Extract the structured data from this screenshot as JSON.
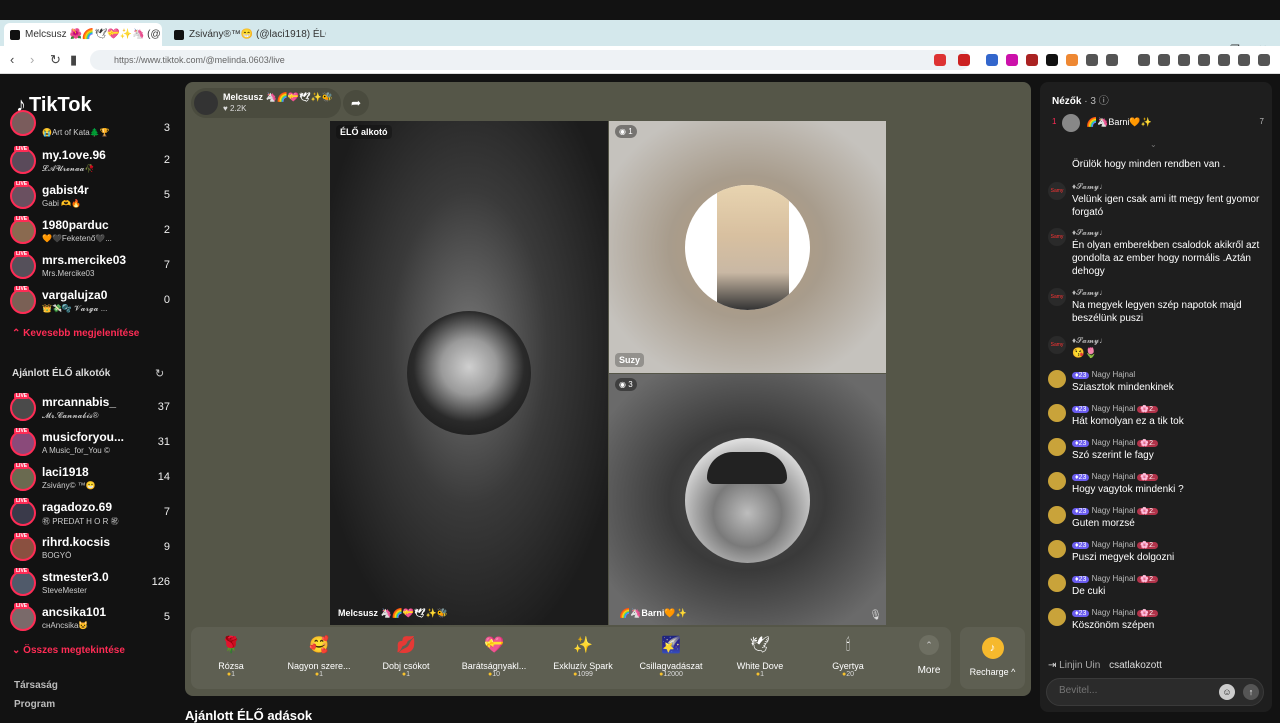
{
  "browser": {
    "tabs": [
      {
        "title": "Melcsusz 🌺🌈🕊💝✨🦄 (@"
      },
      {
        "title": "Zsivány®™😁 (@laci1918) ÉLŐ a"
      }
    ],
    "new_tab": "+",
    "url": "https://www.tiktok.com/@melinda.0603/live"
  },
  "sidebar": {
    "logo": "TikTok",
    "following": [
      {
        "name": "",
        "sub": "😭Art of Kata🌲🏆",
        "count": "3"
      },
      {
        "name": "my.1ove.96",
        "sub": "𝓛𝓐𝓤𝓻𝓮𝓷𝓪𝓪🥀",
        "count": "2"
      },
      {
        "name": "gabist4r",
        "sub": "Gabi 🫶🔥",
        "count": "5"
      },
      {
        "name": "1980parduc",
        "sub": "🧡🖤Feketenő🖤...",
        "count": "2"
      },
      {
        "name": "mrs.mercike03",
        "sub": "Mrs.Mercike03",
        "count": "7"
      },
      {
        "name": "vargalujza0",
        "sub": "👑💸🫧 𝓥𝓪𝓻𝓰𝓪 ...",
        "count": "0"
      }
    ],
    "show_less": "Kevesebb megjelenítése",
    "recommended_title": "Ajánlott ÉLŐ alkotók",
    "recommended": [
      {
        "name": "mrcannabis_",
        "sub": "𝓜𝓻.𝓒𝓪𝓷𝓷𝓪𝓫𝓲𝓼®",
        "count": "37"
      },
      {
        "name": "musicforyou...",
        "sub": "A Music_for_You ©",
        "count": "31"
      },
      {
        "name": "laci1918",
        "sub": "Zsivány© ™😁",
        "count": "14"
      },
      {
        "name": "ragadozo.69",
        "sub": "㊗ PREDAT H O R ㊗",
        "count": "7"
      },
      {
        "name": "rihrd.kocsis",
        "sub": "BOGYÓ",
        "count": "9"
      },
      {
        "name": "stmester3.0",
        "sub": "SteveMester",
        "count": "126"
      },
      {
        "name": "ancsika101",
        "sub": "cнAncsika😺",
        "count": "5"
      }
    ],
    "show_all": "Összes megtekintése",
    "footer": [
      "Társaság",
      "Program"
    ]
  },
  "live": {
    "host_name": "Melcsusz 🦄🌈💝🕊✨🐝",
    "host_likes": "♥ 2.2K",
    "main_label": "ÉLŐ alkotó",
    "main_bottom": "Melcsusz 🦄🌈💝🕊✨🐝",
    "suzy_badge": "◉ 1",
    "suzy_name": "Suzy",
    "barni_badge": "◉ 3",
    "barni_name": "🌈🦄Barni🧡✨",
    "gifts": [
      {
        "name": "Rózsa",
        "price": "1",
        "icon": "🌹"
      },
      {
        "name": "Nagyon szere...",
        "price": "1",
        "icon": "🥰"
      },
      {
        "name": "Dobj csókot",
        "price": "1",
        "icon": "💋"
      },
      {
        "name": "Barátságnyakl...",
        "price": "10",
        "icon": "💝"
      },
      {
        "name": "Exkluzív Spark",
        "price": "1099",
        "icon": "✨"
      },
      {
        "name": "Csillagvadászat",
        "price": "12000",
        "icon": "🌠"
      },
      {
        "name": "White Dove",
        "price": "1",
        "icon": "🕊"
      },
      {
        "name": "Gyertya",
        "price": "20",
        "icon": "🕯"
      }
    ],
    "more_label": "More",
    "recharge_label": "Recharge ^",
    "recommended_live_title": "Ajánlott ÉLŐ adások"
  },
  "chat": {
    "viewers_label": "Nézők",
    "viewers_count": "· 3",
    "top_viewer": {
      "rank": "1",
      "name": "🌈🦄Barni🧡✨",
      "count": "7"
    },
    "messages": [
      {
        "user": "",
        "text": "Örülök hogy minden rendben van .",
        "type": "samy"
      },
      {
        "user": "♦𝓢𝓪𝓶𝔂♩",
        "text": "Velünk igen csak ami itt megy fent gyomor forgató",
        "type": "samy"
      },
      {
        "user": "♦𝓢𝓪𝓶𝔂♩",
        "text": "Én olyan emberekben csalodok akikről azt gondolta az ember hogy normális .Aztán dehogy",
        "type": "samy"
      },
      {
        "user": "♦𝓢𝓪𝓶𝔂♩",
        "text": "Na megyek legyen szép napotok majd beszélünk puszi",
        "type": "samy"
      },
      {
        "user": "♦𝓢𝓪𝓶𝔂♩",
        "text": "😘🌷",
        "type": "samy"
      },
      {
        "user": "Nagy Hajnal",
        "text": "Sziasztok mindenkinek",
        "type": "hajnal"
      },
      {
        "user": "Nagy Hajnal",
        "text": "Hát komolyan ez a tik tok",
        "type": "hajnal"
      },
      {
        "user": "Nagy Hajnal",
        "text": "Szó szerint le fagy",
        "type": "hajnal"
      },
      {
        "user": "Nagy Hajnal",
        "text": "Hogy vagytok mindenki ?",
        "type": "hajnal"
      },
      {
        "user": "Nagy Hajnal",
        "text": "Guten morzsé",
        "type": "hajnal"
      },
      {
        "user": "Nagy Hajnal",
        "text": "Puszi megyek dolgozni",
        "type": "hajnal"
      },
      {
        "user": "Nagy Hajnal",
        "text": "De cuki",
        "type": "hajnal"
      },
      {
        "user": "Nagy Hajnal",
        "text": "Köszönöm szépen",
        "type": "hajnal"
      }
    ],
    "level_badge": "♦23",
    "fan_badge": "🌸2.",
    "join_name": "Linjin Uin",
    "join_text": "csatlakozott",
    "input_placeholder": "Bevitel..."
  }
}
